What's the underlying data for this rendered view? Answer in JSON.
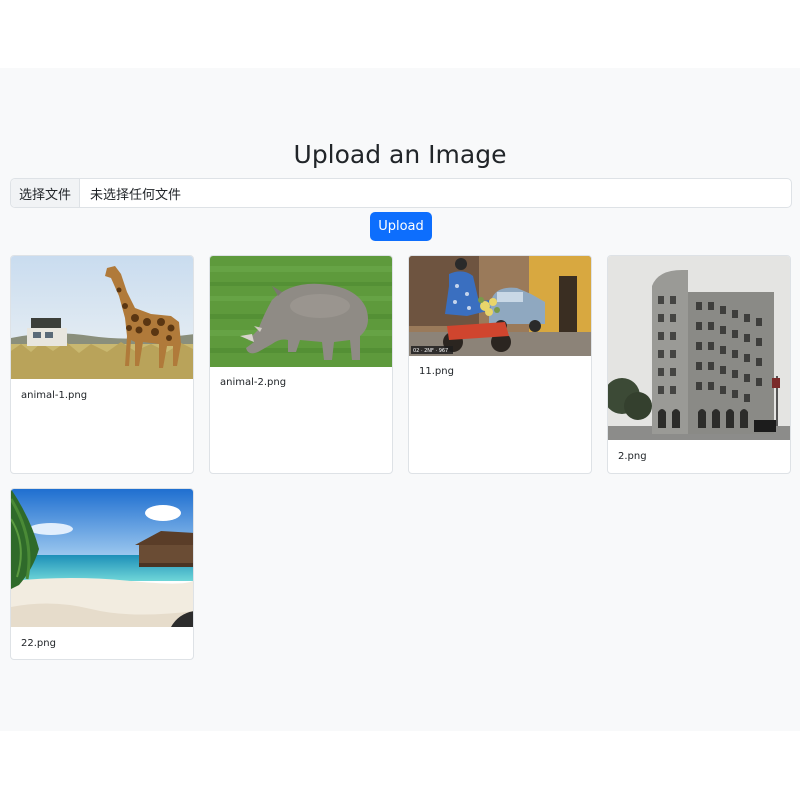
{
  "header": {
    "title": "Upload an Image"
  },
  "file_input": {
    "button_label": "选择文件",
    "status_text": "未选择任何文件"
  },
  "actions": {
    "upload_label": "Upload"
  },
  "colors": {
    "primary": "#0d6efd",
    "page_background": "#f8f9fa",
    "card_border": "#dee2e6"
  },
  "gallery": {
    "items": [
      {
        "filename": "animal-1.png"
      },
      {
        "filename": "animal-2.png"
      },
      {
        "filename": "11.png",
        "watermark": "02 · 2NF · 967"
      },
      {
        "filename": "2.png"
      },
      {
        "filename": "22.png"
      }
    ]
  }
}
